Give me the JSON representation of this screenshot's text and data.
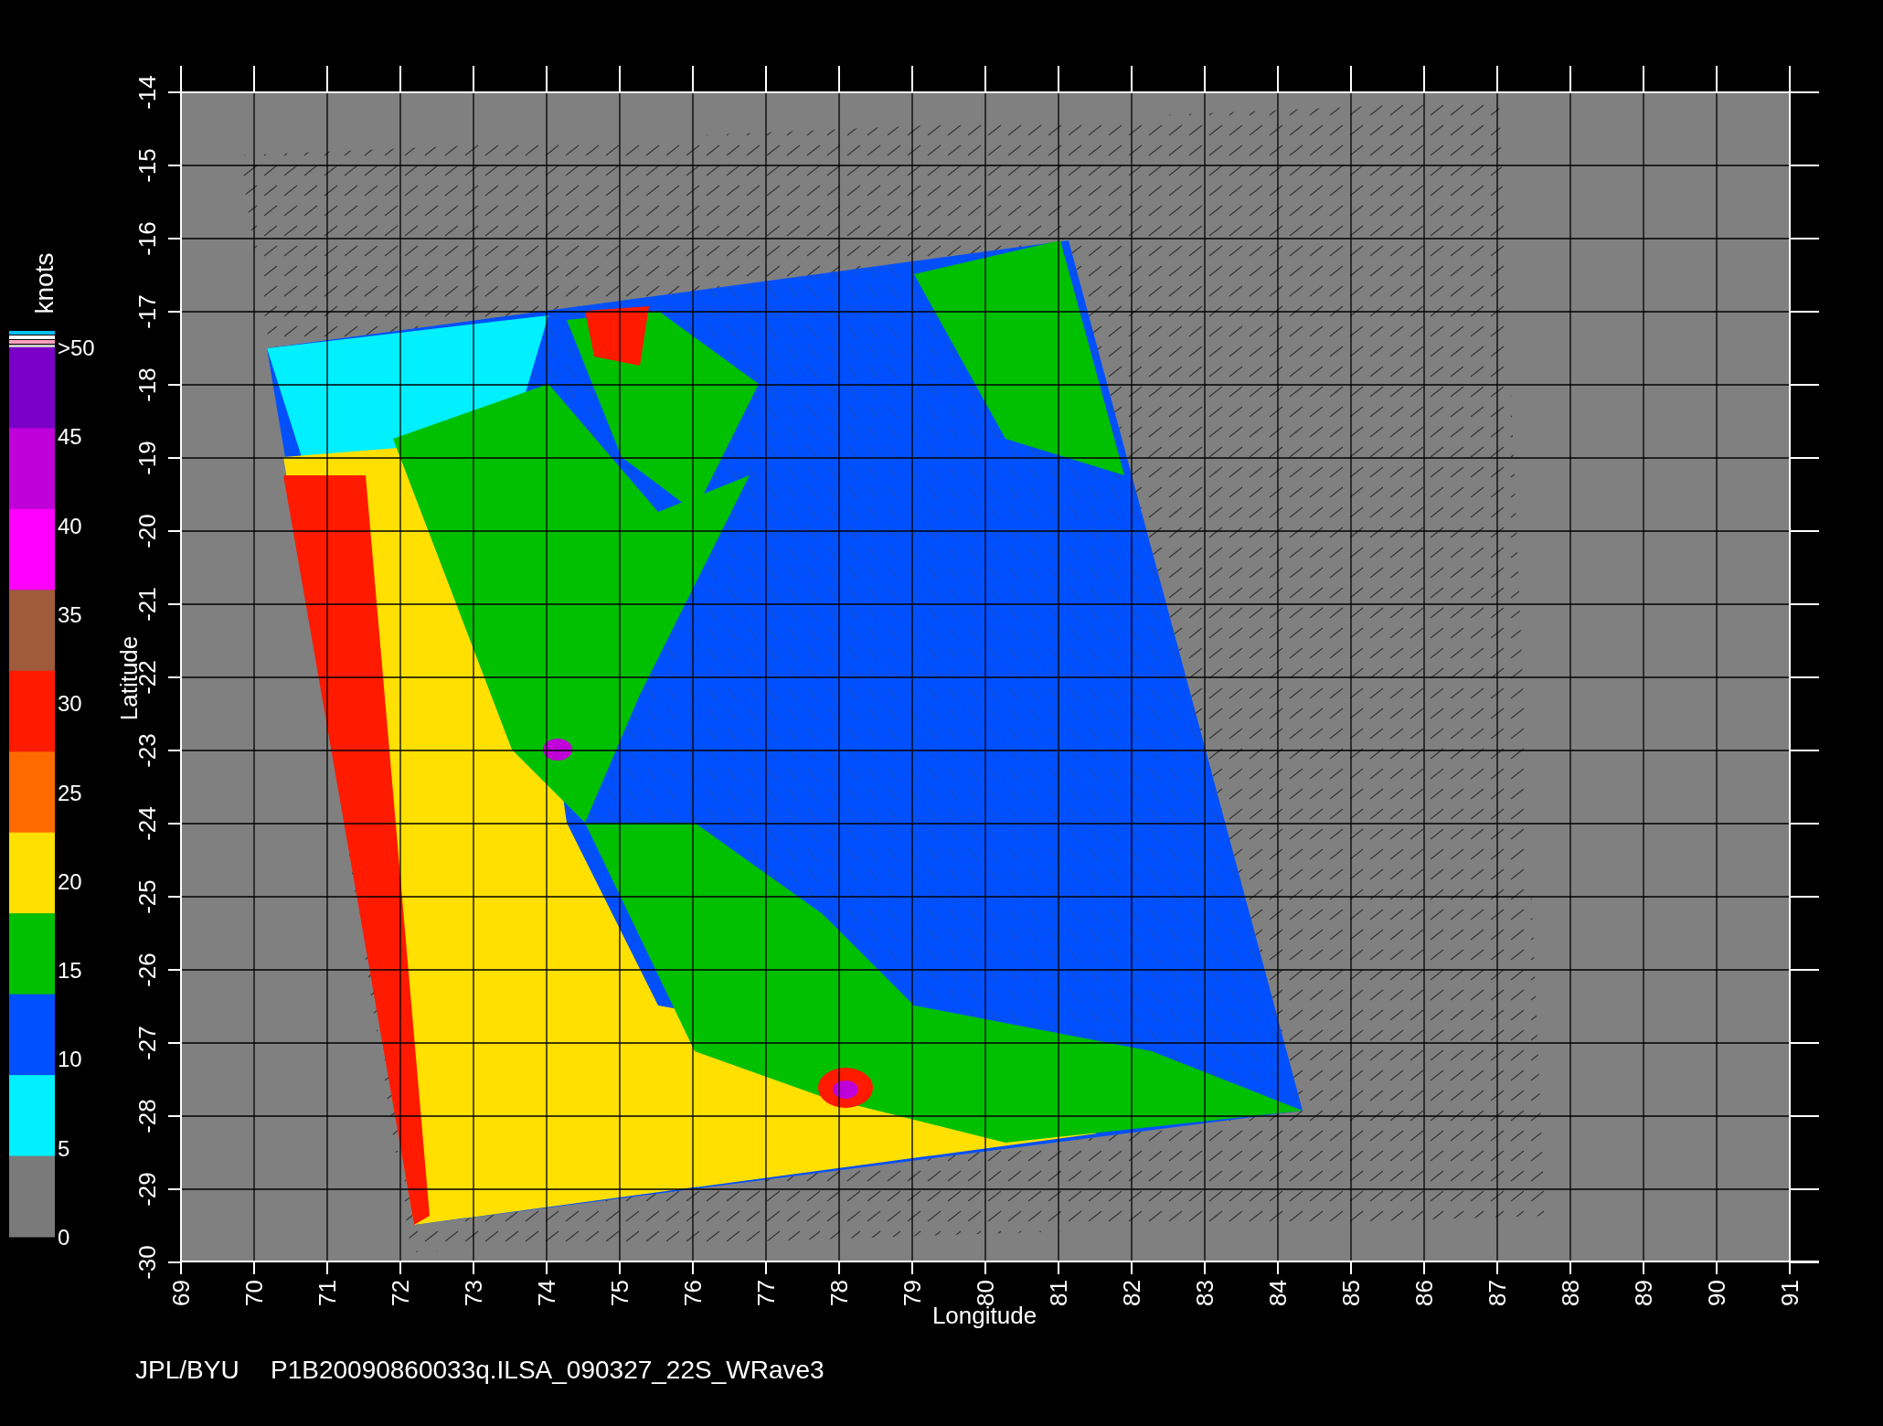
{
  "colorbar": {
    "unit": "knots",
    "labels": [
      {
        "text": ">50",
        "color": "#7a00c8"
      },
      {
        "text": "45",
        "color": "#c000d8"
      },
      {
        "text": "40",
        "color": "#ff00ff"
      },
      {
        "text": "35",
        "color": "#a05a3c"
      },
      {
        "text": "30",
        "color": "#ff1a00"
      },
      {
        "text": "25",
        "color": "#ff6a00"
      },
      {
        "text": "20",
        "color": "#ffe000"
      },
      {
        "text": "15",
        "color": "#00c000"
      },
      {
        "text": "10",
        "color": "#0050ff"
      },
      {
        "text": "5",
        "color": "#00f0ff"
      },
      {
        "text": "0",
        "color": "#7a7a7a"
      }
    ]
  },
  "y_axis": {
    "label": "Latitude",
    "ticks": [
      "-14",
      "-15",
      "-16",
      "-17",
      "-18",
      "-19",
      "-20",
      "-21",
      "-22",
      "-23",
      "-24",
      "-25",
      "-26",
      "-27",
      "-28",
      "-29",
      "-30"
    ]
  },
  "x_axis": {
    "label": "Longitude",
    "ticks": [
      "69",
      "70",
      "71",
      "72",
      "73",
      "74",
      "75",
      "76",
      "77",
      "78",
      "79",
      "80",
      "81",
      "82",
      "83",
      "84",
      "85",
      "86",
      "87",
      "88",
      "89",
      "90",
      "91"
    ]
  },
  "caption": [
    "JPL/BYU",
    "P1B20090860033q.ILSA_090327_22S_WRave3"
  ]
}
